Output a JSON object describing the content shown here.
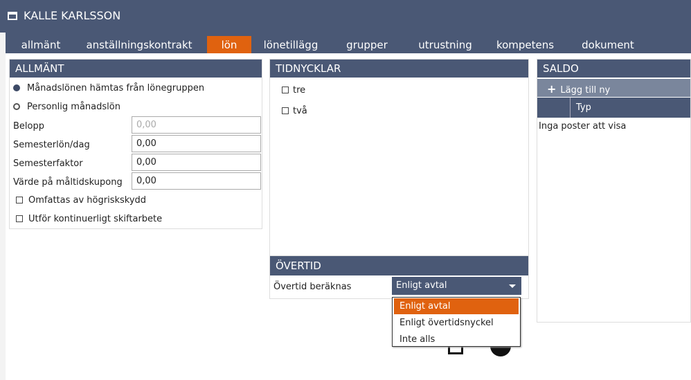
{
  "window": {
    "title": "KALLE KARLSSON"
  },
  "tabs": [
    {
      "label": "allmänt"
    },
    {
      "label": "anställningskontrakt"
    },
    {
      "label": "lön",
      "active": true
    },
    {
      "label": "lönetillägg"
    },
    {
      "label": "grupper"
    },
    {
      "label": "utrustning"
    },
    {
      "label": "kompetens"
    },
    {
      "label": "dokument"
    }
  ],
  "allmant": {
    "title": "ALLMÄNT",
    "radio1": "Månadslönen hämtas från lönegruppen",
    "radio2": "Personlig månadslön",
    "fields": [
      {
        "label": "Belopp",
        "value": "0,00",
        "disabled": true
      },
      {
        "label": "Semesterlön/dag",
        "value": "0,00"
      },
      {
        "label": "Semesterfaktor",
        "value": "0,00"
      },
      {
        "label": "Värde på måltidskupong",
        "value": "0,00"
      }
    ],
    "check1": "Omfattas av högriskskydd",
    "check2": "Utför kontinuerligt skiftarbete"
  },
  "tidnycklar": {
    "title": "TIDNYCKLAR",
    "items": [
      "tre",
      "två"
    ]
  },
  "overtid": {
    "title": "ÖVERTID",
    "label": "Övertid beräknas",
    "selected": "Enligt avtal",
    "options": [
      "Enligt avtal",
      "Enligt övertidsnyckel",
      "Inte alls"
    ]
  },
  "saldo": {
    "title": "SALDO",
    "add": "Lägg till ny",
    "col": "Typ",
    "empty": "Inga poster att visa"
  },
  "colors": {
    "header": "#4a5875",
    "accent": "#e0620f"
  }
}
